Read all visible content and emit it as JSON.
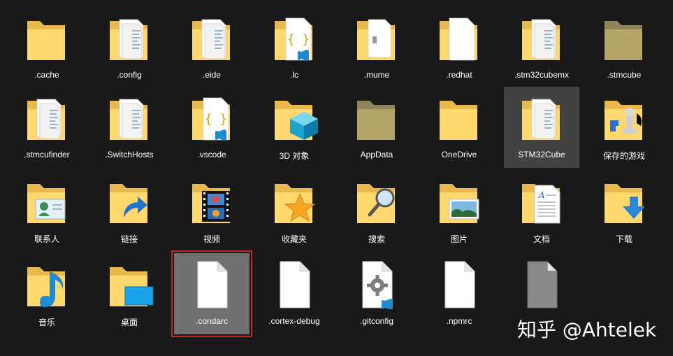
{
  "items": [
    {
      "label": ".cache",
      "icon": "folder-icon",
      "state": ""
    },
    {
      "label": ".config",
      "icon": "folder-with-files-icon",
      "state": ""
    },
    {
      "label": ".eide",
      "icon": "folder-with-files-icon",
      "state": ""
    },
    {
      "label": ".lc",
      "icon": "folder-json-icon",
      "state": ""
    },
    {
      "label": ".mume",
      "icon": "folder-files-icon",
      "state": ""
    },
    {
      "label": ".redhat",
      "icon": "folder-document-icon",
      "state": ""
    },
    {
      "label": ".stm32cubemx",
      "icon": "folder-with-files-icon",
      "state": ""
    },
    {
      "label": ".stmcube",
      "icon": "folder-dim-icon",
      "state": ""
    },
    {
      "label": ".stmcufinder",
      "icon": "folder-with-files-icon",
      "state": ""
    },
    {
      "label": ".SwitchHosts",
      "icon": "folder-with-files-icon",
      "state": ""
    },
    {
      "label": ".vscode",
      "icon": "folder-json-icon",
      "state": ""
    },
    {
      "label": "3D 对象",
      "icon": "folder-3d-objects-icon",
      "state": ""
    },
    {
      "label": "AppData",
      "icon": "folder-dim-icon",
      "state": ""
    },
    {
      "label": "OneDrive",
      "icon": "folder-icon",
      "state": ""
    },
    {
      "label": "STM32Cube",
      "icon": "folder-with-files-icon",
      "state": "selected"
    },
    {
      "label": "保存的游戏",
      "icon": "folder-saved-games-icon",
      "state": ""
    },
    {
      "label": "联系人",
      "icon": "folder-contacts-icon",
      "state": ""
    },
    {
      "label": "链接",
      "icon": "folder-links-icon",
      "state": ""
    },
    {
      "label": "视频",
      "icon": "folder-videos-icon",
      "state": ""
    },
    {
      "label": "收藏夹",
      "icon": "folder-favorites-icon",
      "state": ""
    },
    {
      "label": "搜索",
      "icon": "folder-search-icon",
      "state": ""
    },
    {
      "label": "图片",
      "icon": "folder-pictures-icon",
      "state": ""
    },
    {
      "label": "文档",
      "icon": "folder-documents-icon",
      "state": ""
    },
    {
      "label": "下载",
      "icon": "folder-downloads-icon",
      "state": ""
    },
    {
      "label": "音乐",
      "icon": "folder-music-icon",
      "state": ""
    },
    {
      "label": "桌面",
      "icon": "folder-desktop-icon",
      "state": ""
    },
    {
      "label": ".condarc",
      "icon": "file-icon",
      "state": "hover focus"
    },
    {
      "label": ".cortex-debug",
      "icon": "file-icon",
      "state": ""
    },
    {
      "label": ".gitconfig",
      "icon": "file-gear-vscode-icon",
      "state": ""
    },
    {
      "label": ".npmrc",
      "icon": "file-icon",
      "state": ""
    },
    {
      "label": "",
      "icon": "file-gray-icon",
      "state": ""
    }
  ],
  "watermark": "知乎 @Ahtelek",
  "colors": {
    "background": "#191919",
    "folder_back": "#e8b84a",
    "folder_front": "#ffd86e",
    "file_paper": "#ffffff",
    "selection": "#3a3a3a",
    "focus_outline": "#c0252a",
    "vscode_blue": "#1f8ad2"
  }
}
